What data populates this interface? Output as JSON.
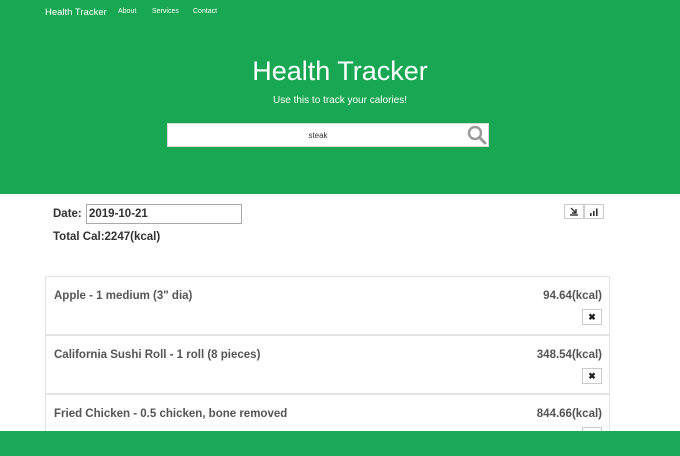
{
  "nav": {
    "brand": "Health Tracker",
    "links": [
      "About",
      "Services",
      "Contact"
    ]
  },
  "hero": {
    "title": "Health Tracker",
    "subtitle": "Use this to track your calories!",
    "search_value": "steak",
    "search_icon": "search-icon"
  },
  "summary": {
    "date_label": "Date:",
    "date_value": "2019-10-21",
    "total_label": "Total Cal:2247(kcal)",
    "tool_icons": [
      "download-icon",
      "bar-chart-icon"
    ]
  },
  "foods": [
    {
      "name": "Apple - 1 medium (3\" dia)",
      "calories": "94.64(kcal)",
      "delete_label": "✖"
    },
    {
      "name": "California Sushi Roll - 1 roll (8 pieces)",
      "calories": "348.54(kcal)",
      "delete_label": "✖"
    },
    {
      "name": "Fried Chicken - 0.5 chicken, bone removed",
      "calories": "844.66(kcal)",
      "delete_label": "✖"
    }
  ],
  "colors": {
    "primary": "#18a853",
    "footer": "#1daa59"
  }
}
